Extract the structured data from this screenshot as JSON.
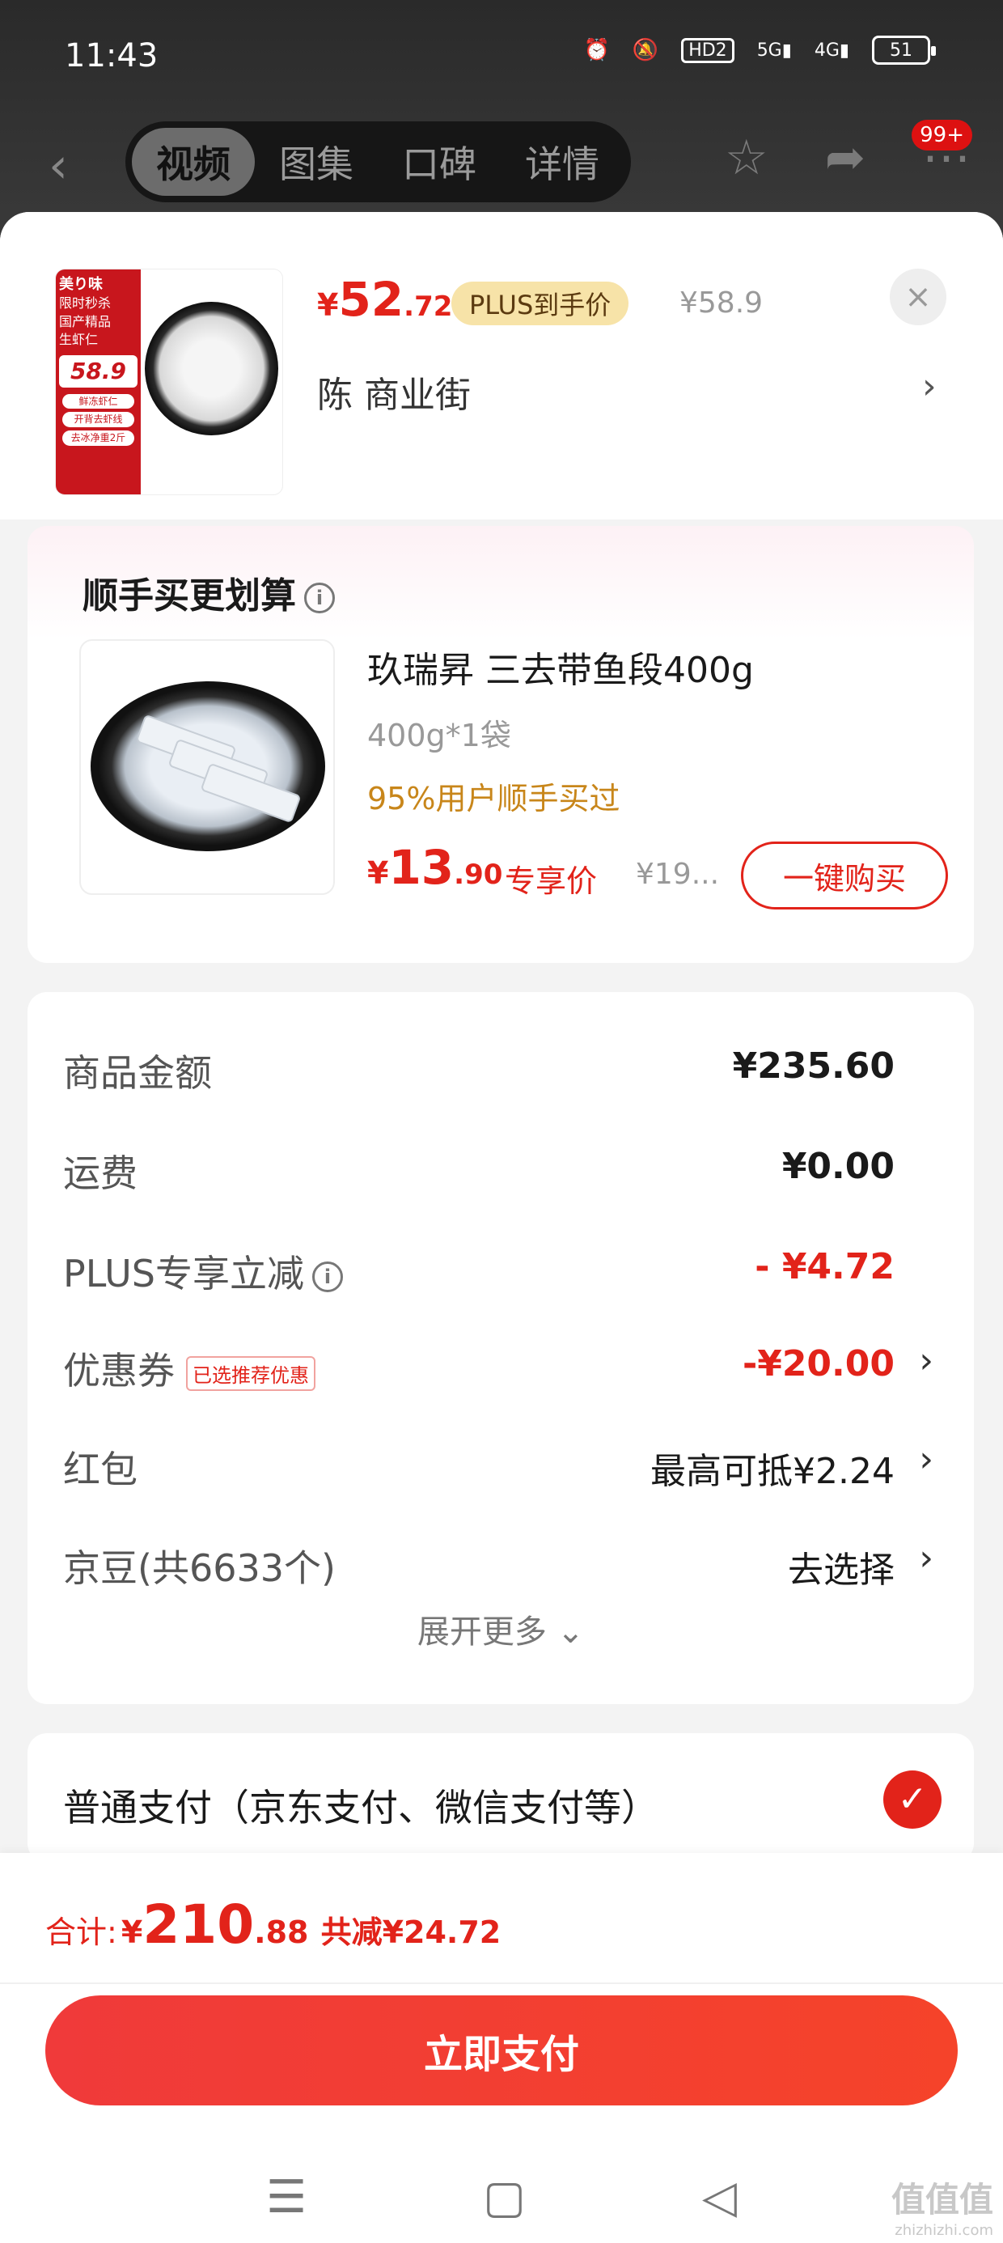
{
  "status_bar": {
    "time": "11:43",
    "hd": "HD2",
    "sig1": "5G",
    "sig2": "4G",
    "battery": "51"
  },
  "nav": {
    "tabs": [
      "视频",
      "图集",
      "口碑",
      "详情"
    ],
    "active_tab": 0,
    "badge": "99+"
  },
  "product": {
    "currency": "¥",
    "price_int": "52",
    "price_dec": ".72",
    "plus_tag": "PLUS到手价",
    "orig_price": "¥58.9",
    "address": "陈  商业街",
    "thumb_brand": "美り味",
    "thumb_price": "58.9",
    "thumb_lines": [
      "限时秒杀",
      "国产精品",
      "生虾仁"
    ],
    "thumb_pills": [
      "鲜冻虾仁",
      "开背去虾线",
      "去冰净重2斤"
    ]
  },
  "bundle": {
    "title": "顺手买更划算",
    "name": "玖瑞昇 三去带鱼段400g",
    "spec": "400g*1袋",
    "rate": "95%用户顺手买过",
    "currency": "¥",
    "price_int": "13",
    "price_dec": ".90",
    "exclusive": "专享价",
    "orig_price": "¥19...",
    "buy_label": "一键购买"
  },
  "summary": {
    "rows": [
      {
        "label": "商品金额",
        "value": "¥235.60"
      },
      {
        "label": "运费",
        "value": "¥0.00"
      },
      {
        "label": "PLUS专享立减",
        "value": "- ¥4.72"
      },
      {
        "label": "优惠券",
        "value": "-¥20.00",
        "tag": "已选推荐优惠"
      },
      {
        "label": "红包",
        "value": "最高可抵¥2.24"
      },
      {
        "label": "京豆(共6633个)",
        "value": "去选择"
      }
    ],
    "more": "展开更多"
  },
  "payment": {
    "label": "普通支付（京东支付、微信支付等）"
  },
  "bottom": {
    "total_label": "合计:",
    "currency": "¥",
    "total_int": "210",
    "total_dec": ".88",
    "save": "共减¥24.72",
    "pay_button": "立即支付"
  },
  "watermark": {
    "main": "值值值",
    "sub": "zhizhizhi.com"
  },
  "colors": {
    "accent": "#e2231a",
    "plus_bg": "#f7e3a8",
    "rate": "#c8861a"
  },
  "icons": [
    "back-icon",
    "star-icon",
    "share-icon",
    "more-icon",
    "close-icon",
    "chevron-right-icon",
    "info-icon",
    "check-icon",
    "alarm-icon",
    "mute-icon"
  ]
}
